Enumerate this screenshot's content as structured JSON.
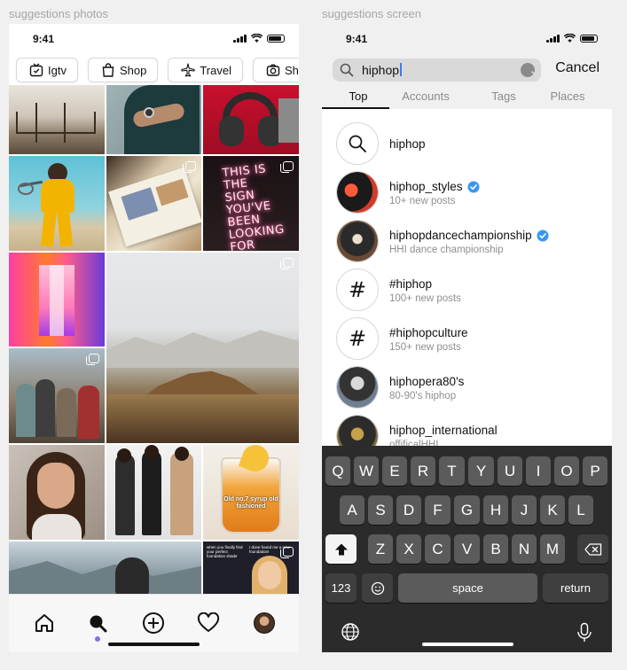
{
  "labels": {
    "left_frame": "suggestions photos",
    "right_frame": "suggestions screen"
  },
  "status": {
    "time": "9:41"
  },
  "left": {
    "chips": [
      {
        "label": "Igtv",
        "icon": "tv-icon"
      },
      {
        "label": "Shop",
        "icon": "shopping-bag-icon"
      },
      {
        "label": "Travel",
        "icon": "airplane-icon"
      },
      {
        "label": "Sho",
        "icon": "camera-icon"
      }
    ],
    "tile_captions": {
      "neon_sign": "THIS IS THE SIGN YOU'VE BEEN LOOKING FOR",
      "drink": "Old no.7 syrup old fashioned",
      "meme": "I done found me a new foundation!",
      "meme_sub": "when you finally find your perfect foundation shade"
    },
    "tabs": [
      "home-icon",
      "search-icon",
      "add-icon",
      "heart-icon",
      "profile-avatar"
    ]
  },
  "right": {
    "search": {
      "value": "hiphop",
      "cancel": "Cancel"
    },
    "segments": [
      "Top",
      "Accounts",
      "Tags",
      "Places"
    ],
    "active_segment": "Top",
    "results": [
      {
        "type": "search",
        "title": "hiphop",
        "subtitle": ""
      },
      {
        "type": "account",
        "title": "hiphop_styles",
        "verified": true,
        "subtitle": "10+ new posts"
      },
      {
        "type": "account",
        "title": "hiphopdancechampionship",
        "verified": true,
        "subtitle": "HHI dance championship"
      },
      {
        "type": "tag",
        "title": "#hiphop",
        "subtitle": "100+ new posts"
      },
      {
        "type": "tag",
        "title": "#hiphopculture",
        "subtitle": "150+ new posts"
      },
      {
        "type": "account",
        "title": "hiphopera80's",
        "verified": false,
        "subtitle": "80-90's hiphop"
      },
      {
        "type": "account",
        "title": "hiphop_international",
        "verified": false,
        "subtitle": "offificalHHI"
      }
    ],
    "keyboard": {
      "row1": [
        "Q",
        "W",
        "E",
        "R",
        "T",
        "Y",
        "U",
        "I",
        "O",
        "P"
      ],
      "row2": [
        "A",
        "S",
        "D",
        "F",
        "G",
        "H",
        "J",
        "K",
        "L"
      ],
      "row3": [
        "Z",
        "X",
        "C",
        "V",
        "B",
        "N",
        "M"
      ],
      "numbers": "123",
      "space": "space",
      "return": "return"
    }
  },
  "colors": {
    "accent": "#3897f0",
    "tab_dot": "#8a6ddf",
    "keyboard_bg": "#2b2b2b"
  }
}
